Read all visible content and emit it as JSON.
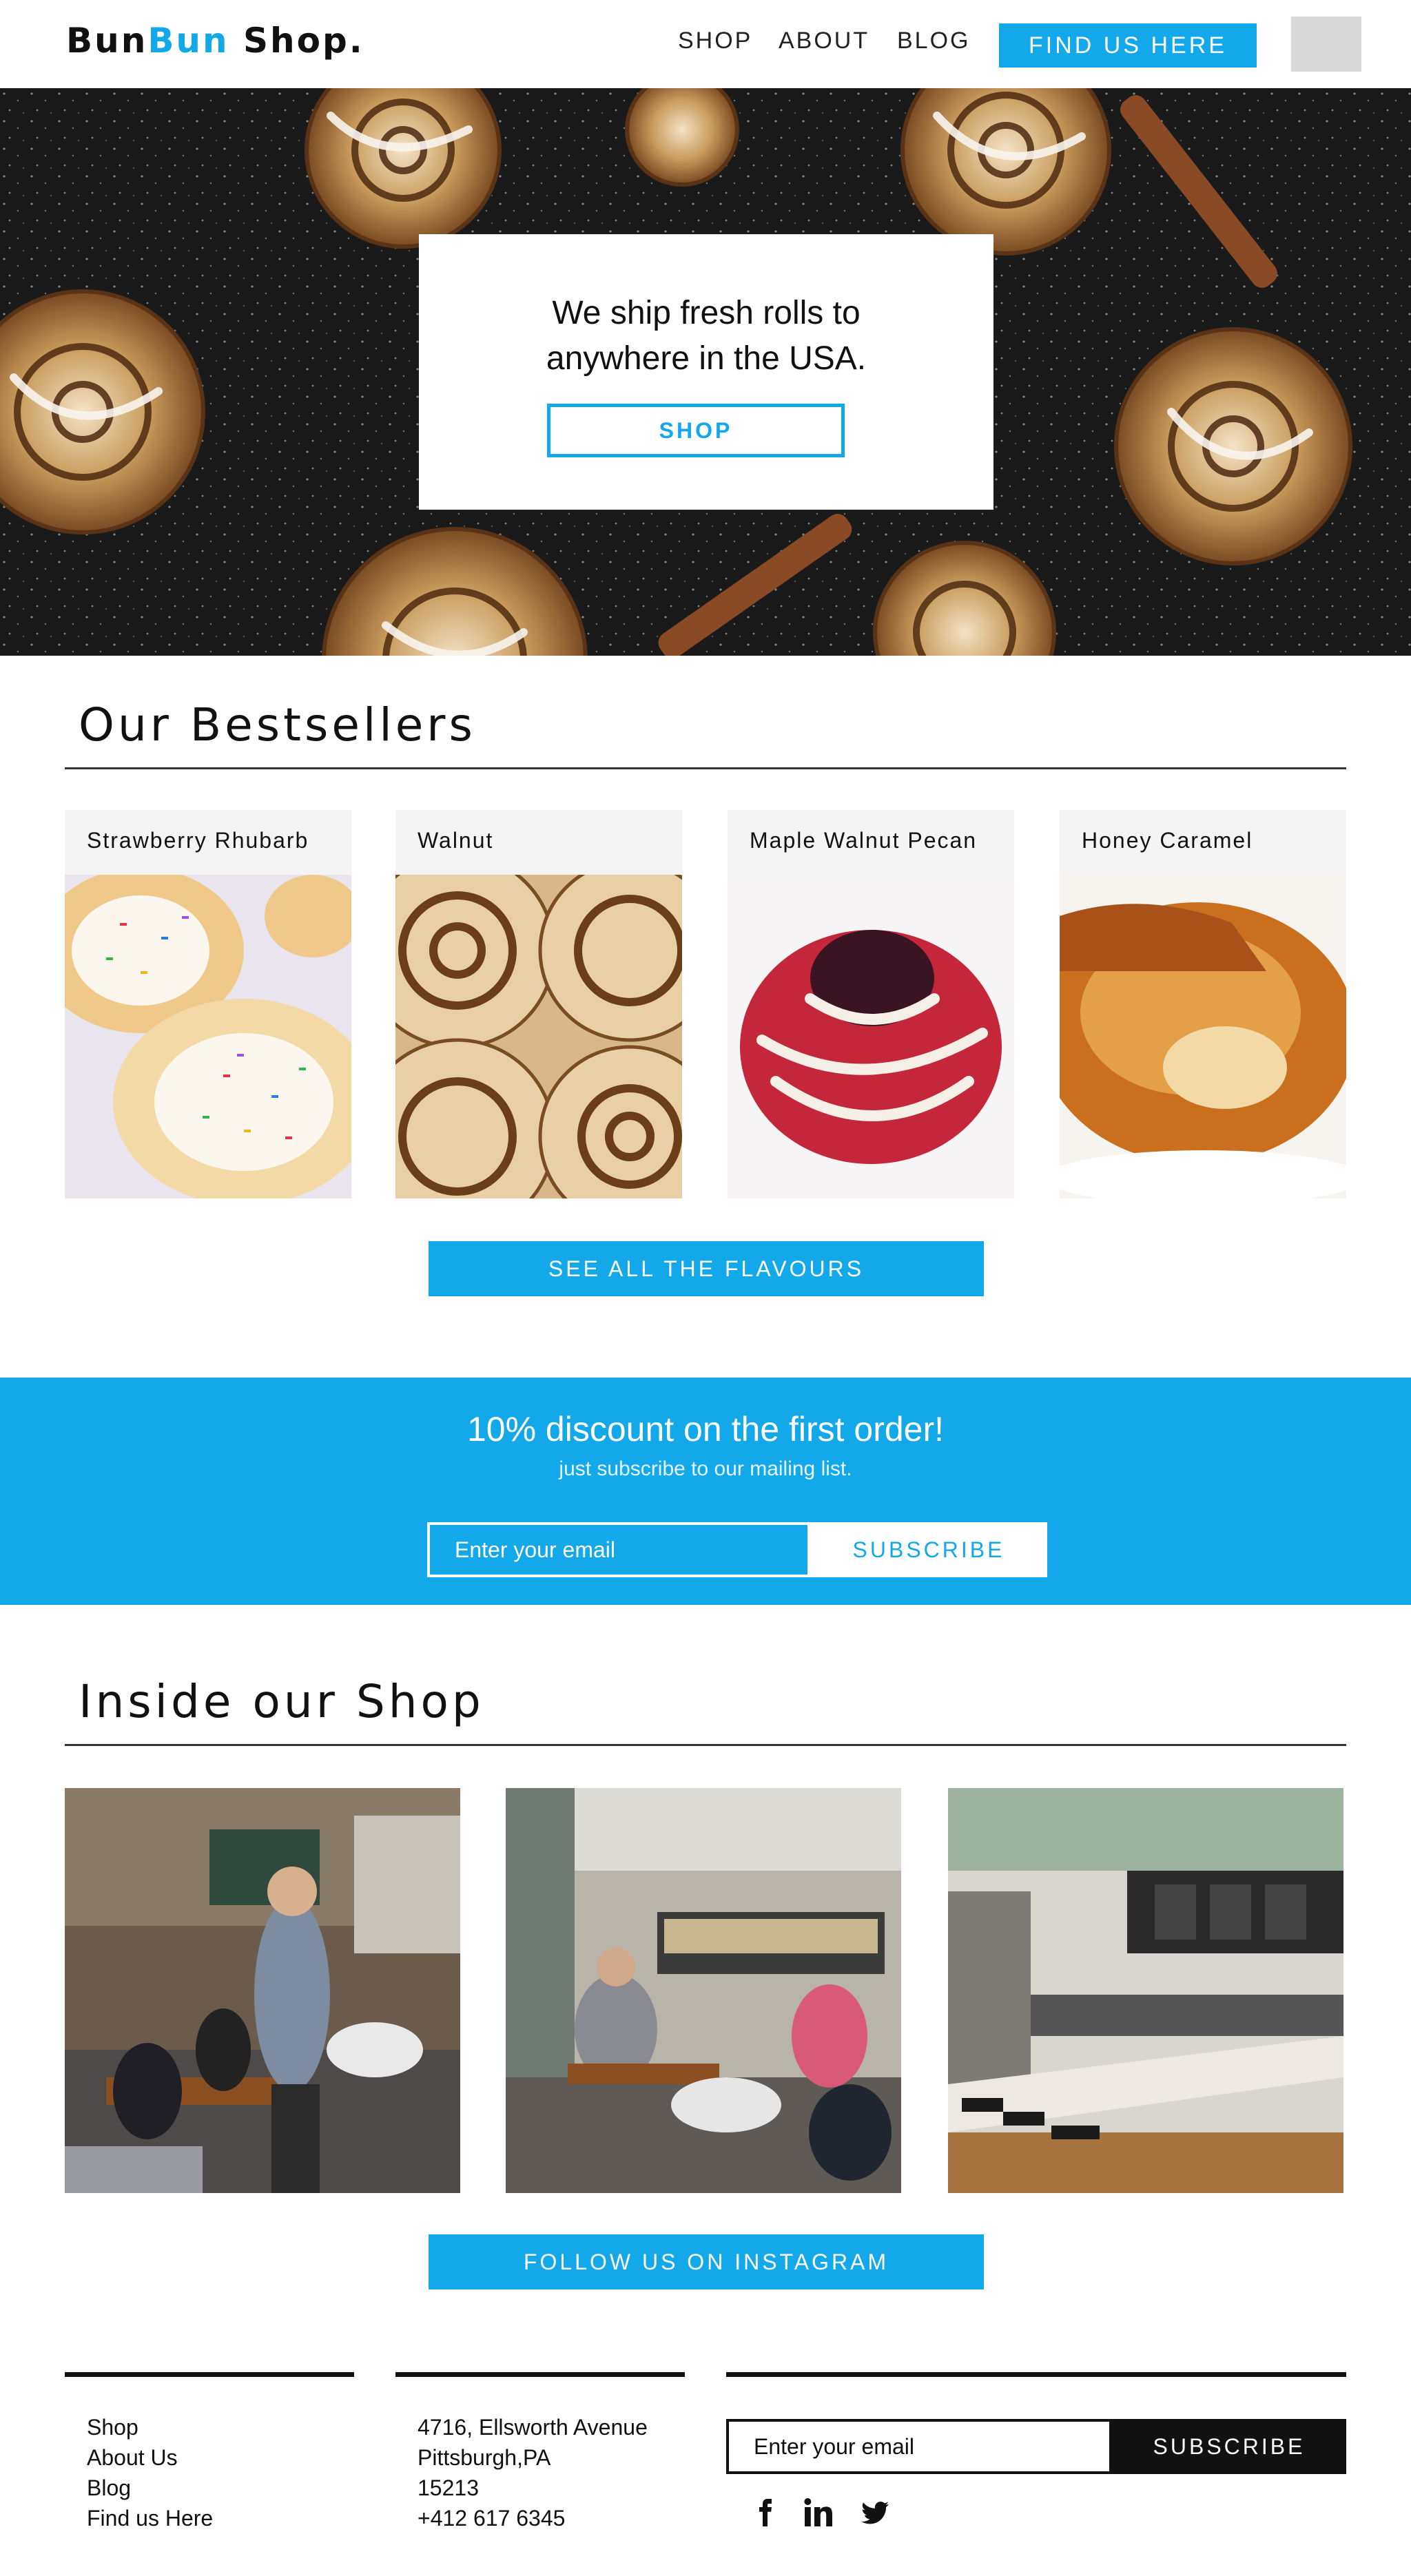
{
  "header": {
    "logo_part1": "Bun",
    "logo_part2": "Bun",
    "logo_part3": " Shop.",
    "nav": [
      "SHOP",
      "ABOUT",
      "BLOG"
    ],
    "cta": "FIND US HERE"
  },
  "hero": {
    "line1": "We ship fresh rolls to",
    "line2": "anywhere in the USA.",
    "button": "SHOP"
  },
  "bestsellers": {
    "title": "Our Bestsellers",
    "items": [
      {
        "name": "Strawberry Rhubarb"
      },
      {
        "name": "Walnut"
      },
      {
        "name": "Maple Walnut Pecan"
      },
      {
        "name": "Honey Caramel"
      }
    ],
    "button": "SEE ALL THE FLAVOURS"
  },
  "discount": {
    "title": "10% discount on the first order!",
    "subtitle": "just subscribe to our mailing list.",
    "placeholder": "Enter your email",
    "button": "SUBSCRIBE"
  },
  "shop": {
    "title": "Inside our Shop",
    "button": "FOLLOW US ON INSTAGRAM"
  },
  "footer": {
    "links": [
      "Shop",
      "About Us",
      "Blog",
      "Find us Here"
    ],
    "address": [
      "4716, Ellsworth Avenue",
      "Pittsburgh,PA",
      "15213",
      "+412 617 6345"
    ],
    "placeholder": "Enter your email",
    "button": "SUBSCRIBE",
    "social_icons": [
      "facebook-icon",
      "linkedin-icon",
      "twitter-icon"
    ]
  },
  "colors": {
    "accent": "#12a8ea",
    "dark": "#111111",
    "card_bg": "#f4f4f4"
  }
}
